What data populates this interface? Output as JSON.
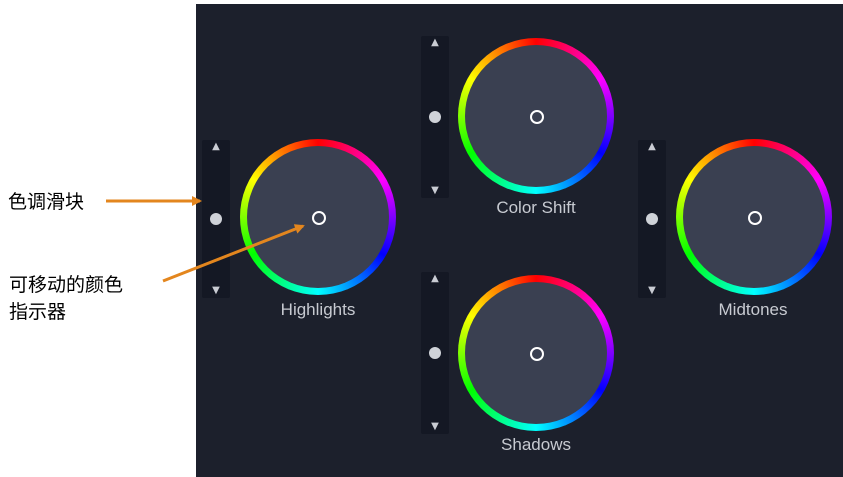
{
  "annotations": {
    "hue_slider": "色调滑块",
    "color_indicator_line1": "可移动的颜色",
    "color_indicator_line2": "指示器"
  },
  "wheels": {
    "highlights": "Highlights",
    "color_shift": "Color Shift",
    "midtones": "Midtones",
    "shadows": "Shadows"
  },
  "icons": {
    "up_arrow": "▲",
    "down_arrow": "▼"
  },
  "colors": {
    "panel_background": "#1c202c",
    "slider_track": "#141824",
    "wheel_center": "#3a4051",
    "label_text": "#c7cad1",
    "annotation_arrow": "#e3861e"
  }
}
